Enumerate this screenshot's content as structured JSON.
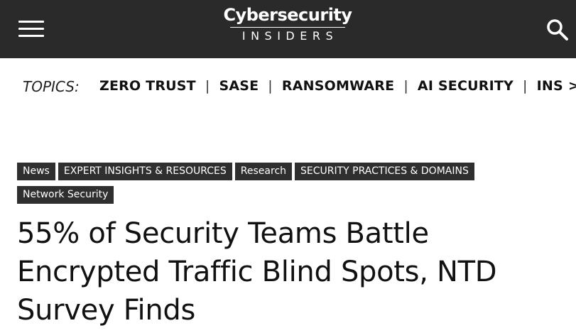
{
  "header": {
    "logo_top": "Cybersecurity",
    "logo_bottom": "INSIDERS",
    "menu_icon": "hamburger-menu-icon",
    "search_icon": "search-icon",
    "background": "#2a2a2a"
  },
  "topics": {
    "label": "TOPICS:",
    "items": [
      "ZERO TRUST",
      "SASE",
      "RANSOMWARE",
      "AI SECURITY",
      "INS"
    ],
    "separator": "|",
    "overflow_indicator": ">"
  },
  "article": {
    "tags": [
      "News",
      "EXPERT INSIGHTS & RESOURCES",
      "Research",
      "SECURITY PRACTICES & DOMAINS",
      "Network Security"
    ],
    "title": "55% of Security Teams Battle Encrypted Traffic Blind Spots, NTD Survey Finds"
  }
}
